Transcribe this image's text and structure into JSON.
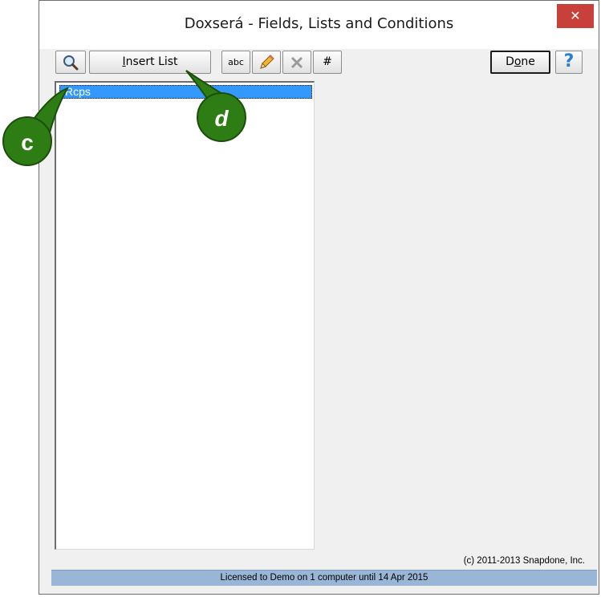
{
  "window": {
    "title": "Doxserá - Fields, Lists and Conditions",
    "close_glyph": "✕"
  },
  "toolbar": {
    "search_icon": "magnifier-icon",
    "insert_list_label": "Insert List",
    "insert_list_mnemonic": "I",
    "insert_list_rest": "nsert List",
    "abc_label": "abc",
    "edit_icon": "pencil-icon",
    "delete_icon": "x-delete-icon",
    "hash_label": "#",
    "done_prefix": "D",
    "done_mnemonic": "o",
    "done_suffix": "ne",
    "help_label": "?"
  },
  "list": {
    "items": [
      {
        "label": "Rcps",
        "selected": true
      }
    ]
  },
  "footer": {
    "copyright": "(c) 2011-2013 Snapdone, Inc.",
    "status": "Licensed to Demo on 1 computer until 14 Apr 2015"
  },
  "callouts": {
    "c": "c",
    "d": "d"
  },
  "colors": {
    "selection": "#3399ff",
    "statusbar": "#9ab6d7",
    "callout": "#2e7d14",
    "close": "#c7403a",
    "help": "#2a7fd4"
  }
}
